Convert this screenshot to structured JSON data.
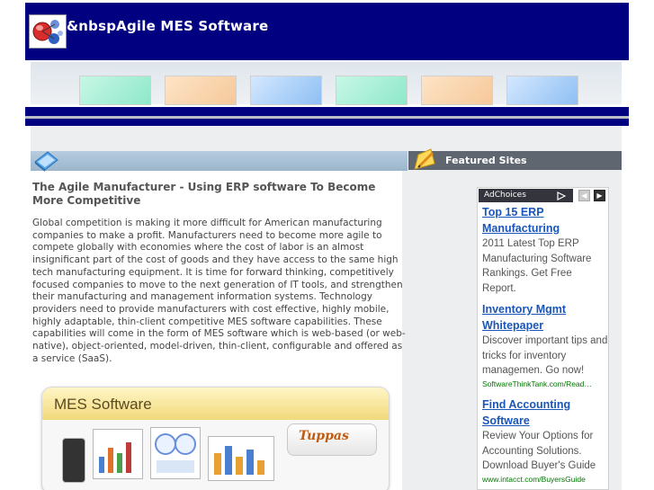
{
  "site": {
    "title": "&nbspAgile MES Software"
  },
  "sidebar": {
    "featured_title": "Featured Sites"
  },
  "article": {
    "title": "The Agile Manufacturer - Using ERP software To Become More Competitive",
    "body": "Global competition is making it more difficult for American manufacturing companies to make a profit. Manufacturers need to become more agile to compete globally with economies where the cost of labor is an almost insignificant part of the cost of goods and they have access to the same high tech manufacturing equipment. It is time for forward thinking, competitively focused companies to move to the next generation of IT tools, and strengthen their manufacturing and management information systems. Technology providers need to provide manufacturers with cost effective, highly mobile, highly adaptable, thin-client competitive MES software capabilities. These capabilities will come in the form of MES software which is web-based (or web-native), object-oriented, model-driven, thin-client, configurable and offered as a service (SaaS).",
    "image_title": "MES Software",
    "image_logo": "Tuppas"
  },
  "ads": {
    "adchoices_label": "AdChoices",
    "prev_icon": "◀",
    "next_icon": "▶",
    "items": [
      {
        "title_line1": "Top 15 ERP",
        "title_line2": "Manufacturing",
        "desc": "2011 Latest Top ERP Manufacturing Software Rankings. Get Free Report.",
        "url": ""
      },
      {
        "title_line1": "Inventory Mgmt",
        "title_line2": "Whitepaper",
        "desc": "Discover important tips and tricks for inventory managemen. Go now!",
        "url": "SoftwareThinkTank.com/Read…"
      },
      {
        "title_line1": "Find Accounting",
        "title_line2": "Software",
        "desc": "Review Your Options for Accounting Solutions. Download Buyer's Guide",
        "url": "www.intacct.com/BuyersGuide"
      }
    ]
  },
  "icons": {
    "logo": "globe-logo-icon",
    "left_header": "blue-book-icon",
    "right_header": "pencil-note-icon",
    "adchoices": "adchoices-triangle-icon"
  },
  "colors": {
    "header_bg": "#000080",
    "ad_link": "#1a56b8",
    "ad_url": "#007700",
    "featured_bar": "#5f6670"
  }
}
